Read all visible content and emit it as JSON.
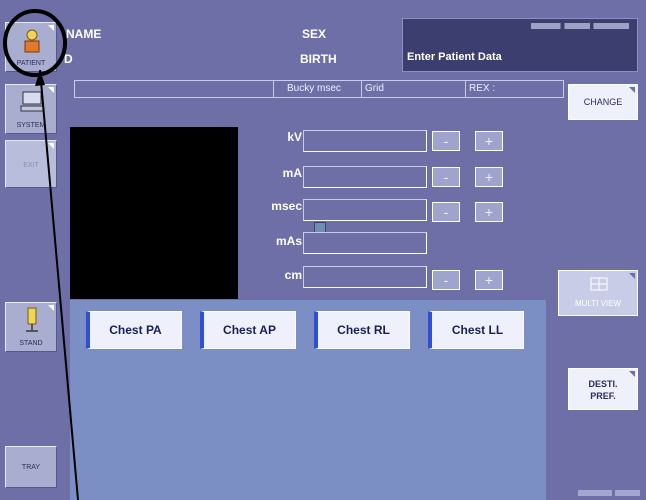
{
  "header": {
    "name_label": "NAME",
    "id_label": "D",
    "sex_label": "SEX",
    "birth_label": "BIRTH",
    "patient_data_text": "Enter Patient Data"
  },
  "info_bar": {
    "bucky": "Bucky msec",
    "grid": "Grid",
    "rex": "REX :"
  },
  "sidebar": {
    "patient": "PATIENT",
    "system": "SYSTEM",
    "exit": "EXIT",
    "stand": "STAND",
    "tray": "TRAY"
  },
  "params": {
    "kv": "kV",
    "ma": "mA",
    "msec": "msec",
    "mas": "mAs",
    "cm": "cm",
    "minus": "-",
    "plus": "+"
  },
  "protocols": [
    "Chest PA",
    "Chest AP",
    "Chest RL",
    "Chest LL"
  ],
  "right_panel": {
    "change": "CHANGE",
    "multi_view": "MULTI VIEW",
    "desti_pref_1": "DESTI.",
    "desti_pref_2": "PREF."
  },
  "colors": {
    "background": "#6d6fa6",
    "protocol_panel": "#7b8fc4",
    "button_accent": "#2f4fd8",
    "annotation": "#000000"
  }
}
